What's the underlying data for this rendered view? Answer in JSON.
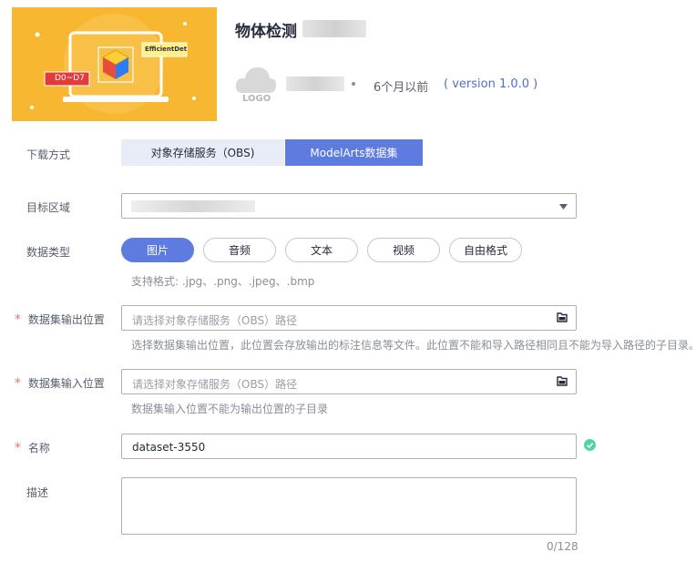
{
  "header": {
    "title": "物体检测",
    "banner": {
      "tag_left": "D0~D7",
      "tag_right": "EfficientDet"
    },
    "logo_text": "LOGO",
    "time": "6个月以前",
    "version": "( version 1.0.0 )"
  },
  "form": {
    "download": {
      "label": "下载方式",
      "options": [
        "对象存储服务（OBS)",
        "ModelArts数据集"
      ],
      "selected": "ModelArts数据集"
    },
    "region": {
      "label": "目标区域"
    },
    "data_type": {
      "label": "数据类型",
      "options": [
        "图片",
        "音频",
        "文本",
        "视频",
        "自由格式"
      ],
      "selected": "图片",
      "hint": "支持格式: .jpg、.png、.jpeg、.bmp"
    },
    "output": {
      "label": "数据集输出位置",
      "placeholder": "请选择对象存储服务（OBS）路径",
      "hint": "选择数据集输出位置，此位置会存放输出的标注信息等文件。此位置不能和导入路径相同且不能为导入路径的子目录。"
    },
    "input": {
      "label": "数据集输入位置",
      "placeholder": "请选择对象存储服务（OBS）路径",
      "hint": "数据集输入位置不能为输出位置的子目录"
    },
    "name": {
      "label": "名称",
      "value": "dataset-3550"
    },
    "desc": {
      "label": "描述",
      "counter": "0/128"
    },
    "required_mark": "*"
  },
  "colors": {
    "primary": "#5e7ce0",
    "banner": "#f7b731",
    "success": "#50d4ab",
    "required": "#f66f6a"
  }
}
